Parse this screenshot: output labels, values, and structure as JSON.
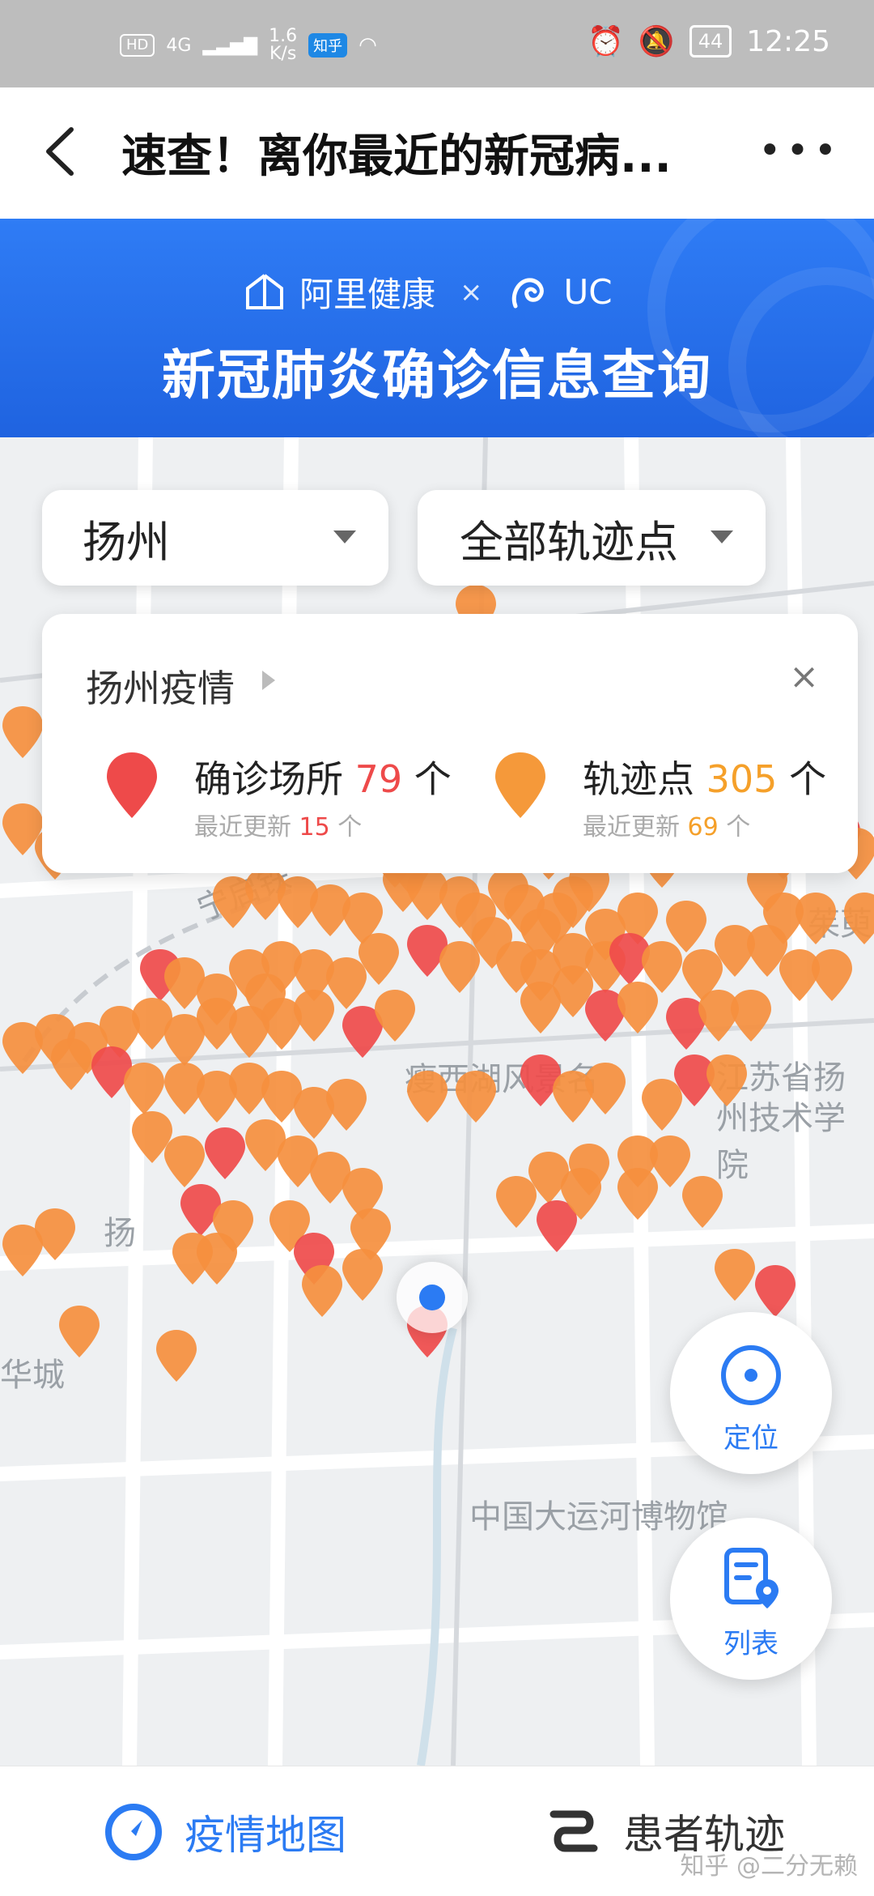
{
  "status_bar": {
    "network_hd": "HD",
    "network_4g": "4G",
    "speed": "1.6",
    "speed_unit": "K/s",
    "zhihu_badge": "知乎",
    "battery": "44",
    "time": "12:25"
  },
  "header": {
    "title": "速查！离你最近的新冠病...",
    "more": "•••"
  },
  "banner": {
    "brand_left": "阿里健康",
    "brand_x": "×",
    "brand_right": "UC",
    "headline": "新冠肺炎确诊信息查询",
    "accent_color": "#2b6ff0"
  },
  "filters": {
    "city": "扬州",
    "trace_filter": "全部轨迹点"
  },
  "summary": {
    "city_label": "扬州疫情",
    "close": "×",
    "confirmed_label": "确诊场所",
    "confirmed_count": "79",
    "confirmed_unit": "个",
    "confirmed_recent_label": "最近更新",
    "confirmed_recent_count": "15",
    "confirmed_recent_unit": "个",
    "trace_label": "轨迹点",
    "trace_count": "305",
    "trace_unit": "个",
    "trace_recent_label": "最近更新",
    "trace_recent_count": "69",
    "trace_recent_unit": "个",
    "confirmed_color": "#ee4a4a",
    "trace_color": "#f5a02a"
  },
  "map": {
    "labels": [
      "宁启铁",
      "茱萸",
      "江苏省扬",
      "州技术学院",
      "瘦西湖风景名",
      "扬",
      "华城",
      "中国大运河博物馆"
    ]
  },
  "fabs": {
    "locate": "定位",
    "list": "列表"
  },
  "bottom_nav": {
    "map_tab": "疫情地图",
    "trace_tab": "患者轨迹",
    "watermark": "知乎 @二分无赖"
  }
}
